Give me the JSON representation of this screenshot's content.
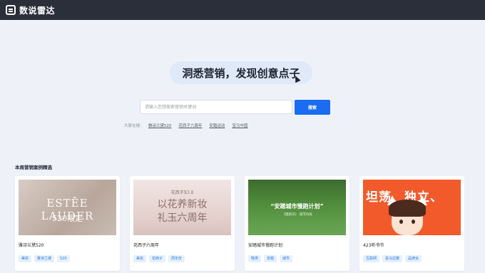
{
  "app": {
    "logo_text": "数说雷达"
  },
  "hero": {
    "title": "洞悉营销，发现创意点子"
  },
  "search": {
    "placeholder": "请输入您想搜索营销关键词",
    "button_label": "搜索"
  },
  "hot": {
    "label": "大家在搜:",
    "keywords": [
      "雅诗兰黛520",
      "花西子六周年",
      "安踏运动",
      "宝马中国"
    ]
  },
  "section": {
    "title": "本周营销案例精选"
  },
  "cards": [
    {
      "name": "雅诗兰黛520",
      "tags": [
        "美妆",
        "雅诗兰黛",
        "520"
      ],
      "thumb_text": [
        "ESTĒE LAUDER",
        "520限定"
      ]
    },
    {
      "name": "花西子六周年",
      "tags": [
        "美妆",
        "花西子",
        "周年庆"
      ],
      "thumb_text": [
        "花西子X3.8",
        "以花养新妆",
        "礼玉六周年"
      ]
    },
    {
      "name": "安踏城市慢跑计划",
      "tags": [
        "鞋类",
        "安踏",
        "城市"
      ],
      "thumb_text": [
        "“安踏城市慢跑计划”",
        "《慢跑日》 城市热线"
      ]
    },
    {
      "name": "423听书节",
      "tags": [
        "互联网",
        "喜马拉雅",
        "品牌会"
      ],
      "thumb_text": [
        "坦荡、独立、"
      ]
    }
  ],
  "colors": {
    "topbar": "#2b2f3a",
    "accent": "#1a6cf0",
    "background": "#eef2f8",
    "tag_text": "#2a7de1"
  }
}
